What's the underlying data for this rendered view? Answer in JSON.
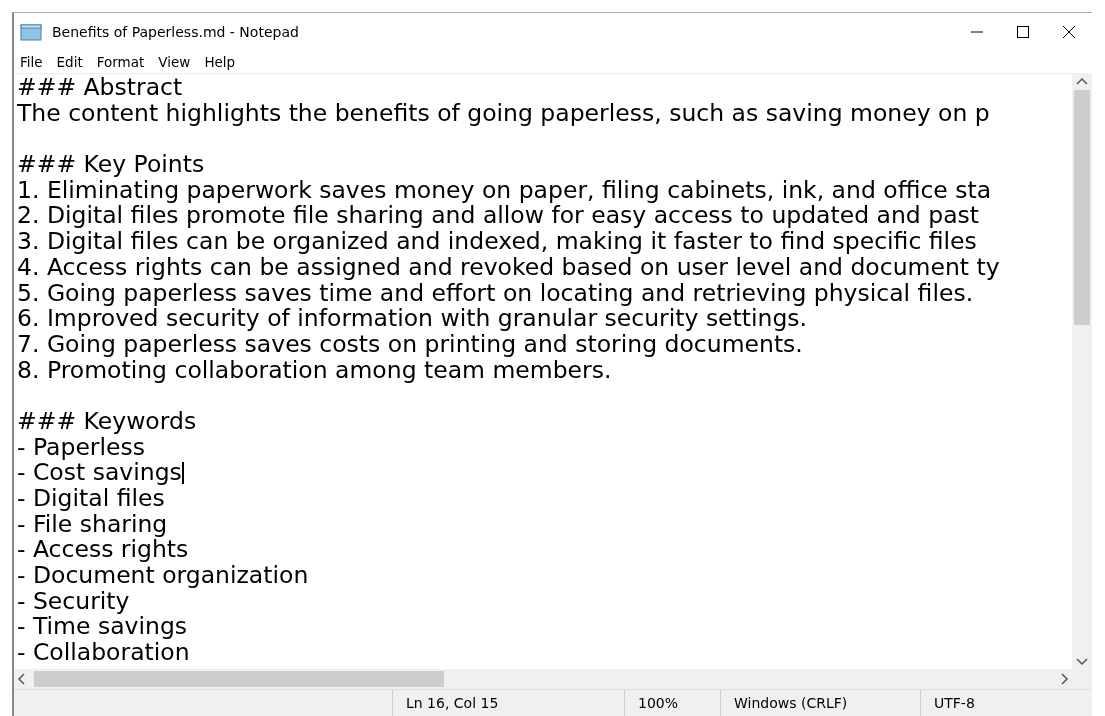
{
  "window": {
    "title": "Benefits of Paperless.md - Notepad"
  },
  "menu": [
    {
      "label": "File"
    },
    {
      "label": "Edit"
    },
    {
      "label": "Format"
    },
    {
      "label": "View"
    },
    {
      "label": "Help"
    }
  ],
  "document": {
    "blocks": [
      {
        "lines": [
          {
            "text": "### Abstract",
            "caret": false
          },
          {
            "text": "The content highlights the benefits of going paperless, such as saving money on p",
            "caret": false
          }
        ]
      },
      {
        "lines": [
          {
            "text": "### Key Points",
            "caret": false
          },
          {
            "text": "1. Eliminating paperwork saves money on paper, filing cabinets, ink, and office sta",
            "caret": false
          },
          {
            "text": "2. Digital files promote file sharing and allow for easy access to updated and past",
            "caret": false
          },
          {
            "text": "3. Digital files can be organized and indexed, making it faster to find specific files",
            "caret": false
          },
          {
            "text": "4. Access rights can be assigned and revoked based on user level and document ty",
            "caret": false
          },
          {
            "text": "5. Going paperless saves time and effort on locating and retrieving physical files.",
            "caret": false
          },
          {
            "text": "6. Improved security of information with granular security settings.",
            "caret": false
          },
          {
            "text": "7. Going paperless saves costs on printing and storing documents.",
            "caret": false
          },
          {
            "text": "8. Promoting collaboration among team members.",
            "caret": false
          }
        ]
      },
      {
        "lines": [
          {
            "text": "### Keywords",
            "caret": false
          },
          {
            "text": "- Paperless",
            "caret": false
          },
          {
            "text": "- Cost savings",
            "caret": true
          },
          {
            "text": "- Digital files",
            "caret": false
          },
          {
            "text": "- File sharing",
            "caret": false
          },
          {
            "text": "- Access rights",
            "caret": false
          },
          {
            "text": "- Document organization",
            "caret": false
          },
          {
            "text": "- Security",
            "caret": false
          },
          {
            "text": "- Time savings",
            "caret": false
          },
          {
            "text": "- Collaboration",
            "caret": false
          }
        ]
      }
    ]
  },
  "status_bar": {
    "position": "Ln 16, Col 15",
    "zoom": "100%",
    "line_ending": "Windows (CRLF)",
    "encoding": "UTF-8"
  }
}
